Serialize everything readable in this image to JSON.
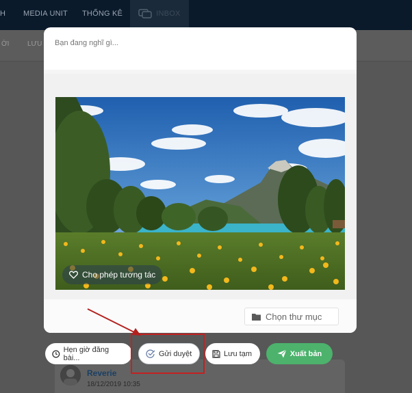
{
  "topbar": {
    "items": [
      {
        "label": "H"
      },
      {
        "label": "MEDIA UNIT"
      },
      {
        "label": "THỐNG KÊ"
      },
      {
        "label": "INBOX"
      }
    ]
  },
  "subbar": {
    "items": [
      {
        "label": "ỜI"
      },
      {
        "label": "LƯU"
      }
    ]
  },
  "composer": {
    "placeholder": "Bạn đang nghĩ gì...",
    "allow_interaction_label": "Cho phép tương tác",
    "folder_label": "Chọn thư mục",
    "photo_icon": "landscape-photo"
  },
  "actions": {
    "schedule_label": "Hẹn giờ đăng bài...",
    "send_review_label": "Gửi duyệt",
    "save_draft_label": "Lưu tạm",
    "publish_label": "Xuất bản"
  },
  "background_post": {
    "author": "Reverie",
    "timestamp": "18/12/2019 10:35"
  },
  "colors": {
    "topbar": "#0b1a2b",
    "publish_button": "#4cb26c",
    "highlight": "#c62020"
  }
}
